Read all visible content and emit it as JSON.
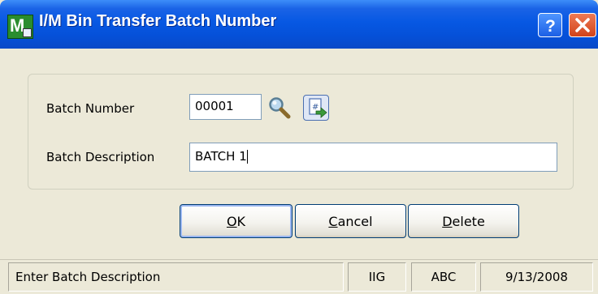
{
  "window": {
    "title": "I/M Bin Transfer Batch Number",
    "help_icon": "help-icon",
    "close_icon": "close-icon"
  },
  "form": {
    "batch_number_label": "Batch Number",
    "batch_number_value": "00001",
    "batch_description_label": "Batch Description",
    "batch_description_value": "BATCH 1",
    "lookup_icon": "magnifier-lookup-icon",
    "next_number_icon": "next-batch-number-icon"
  },
  "buttons": {
    "ok": "OK",
    "cancel": "Cancel",
    "delete": "Delete"
  },
  "statusbar": {
    "message": "Enter Batch Description",
    "company": "IIG",
    "user": "ABC",
    "date": "9/13/2008"
  },
  "colors": {
    "titlebar": "#0758e3",
    "close_button": "#d2431a",
    "dialog_bg": "#ece9d8"
  }
}
